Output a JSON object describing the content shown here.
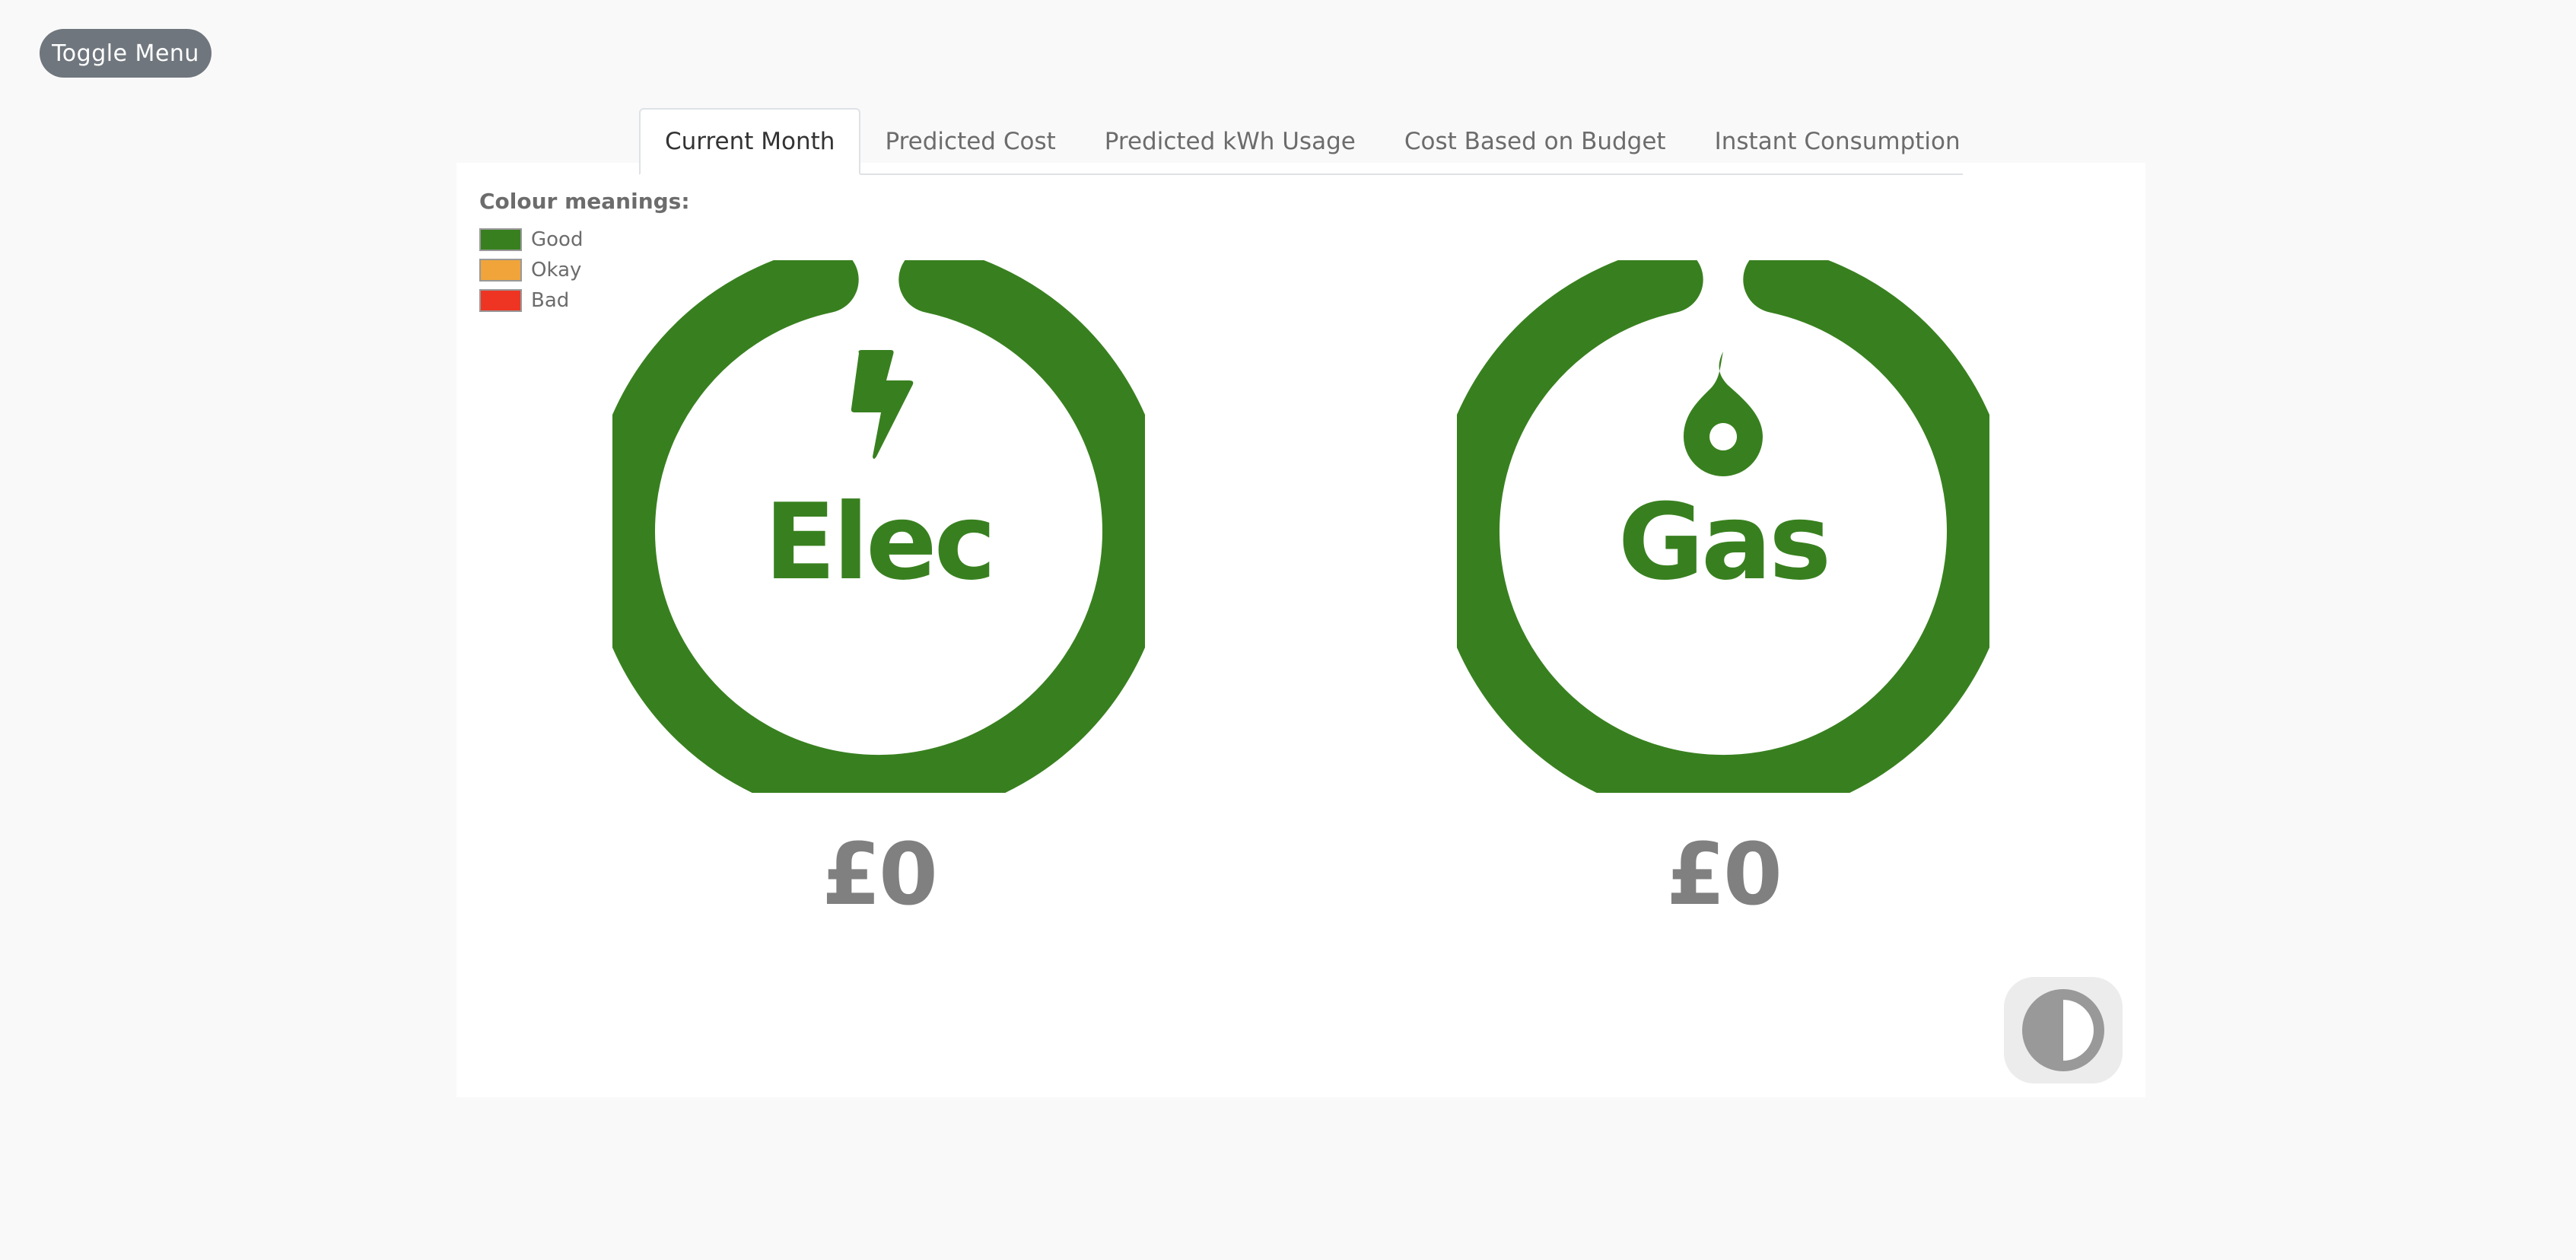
{
  "toggle_menu_label": "Toggle Menu",
  "tabs": [
    {
      "label": "Current Month",
      "active": true
    },
    {
      "label": "Predicted Cost",
      "active": false
    },
    {
      "label": "Predicted kWh Usage",
      "active": false
    },
    {
      "label": "Cost Based on Budget",
      "active": false
    },
    {
      "label": "Instant Consumption",
      "active": false
    }
  ],
  "legend": {
    "title": "Colour meanings:",
    "items": [
      {
        "label": "Good",
        "color": "#38801f"
      },
      {
        "label": "Okay",
        "color": "#f0a43a"
      },
      {
        "label": "Bad",
        "color": "#ee3523"
      }
    ]
  },
  "gauges": [
    {
      "label": "Elec",
      "icon": "lightning-bolt-icon",
      "amount": "£0",
      "color": "#38801f"
    },
    {
      "label": "Gas",
      "icon": "flame-icon",
      "amount": "£0",
      "color": "#38801f"
    }
  ],
  "contrast_icon": "contrast-toggle-icon"
}
